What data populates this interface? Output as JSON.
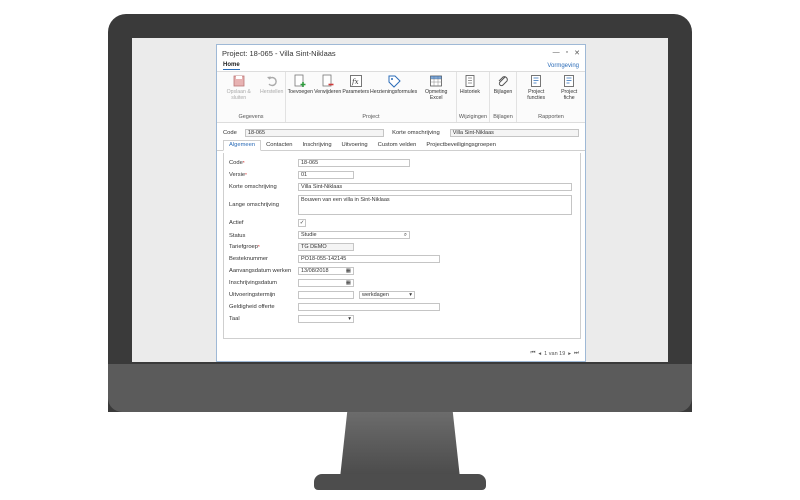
{
  "window": {
    "title": "Project: 18-065 - Villa Sint-Niklaas"
  },
  "ribbon": {
    "tab_home": "Home",
    "tab_vormgeving": "Vormgeving",
    "groups": [
      {
        "label": "Gegevens",
        "buttons": [
          "Opslaan & sluiten",
          "Herstellen"
        ]
      },
      {
        "label": "Project",
        "buttons": [
          "Toevoegen",
          "Verwijderen",
          "Parameters",
          "Herzieningsformules",
          "Opmeting Excel"
        ]
      },
      {
        "label": "Wijzigingen",
        "buttons": [
          "Historiek"
        ]
      },
      {
        "label": "Bijlagen",
        "buttons": [
          "Bijlagen"
        ]
      },
      {
        "label": "Rapporten",
        "buttons": [
          "Project functies",
          "Project fiche"
        ]
      }
    ]
  },
  "header": {
    "code_label": "Code",
    "code_value": "18-065",
    "korte_label": "Korte omschrijving",
    "korte_value": "Villa Sint-Niklaas"
  },
  "tabs": [
    "Algemeen",
    "Contacten",
    "Inschrijving",
    "Uitvoering",
    "Custom velden",
    "Projectbeveiligingsgroepen"
  ],
  "form": {
    "code": {
      "label": "Code",
      "value": "18-065"
    },
    "versie": {
      "label": "Versie",
      "value": "01"
    },
    "korte": {
      "label": "Korte omschrijving",
      "value": "Villa Sint-Niklaas"
    },
    "lange": {
      "label": "Lange omschrijving",
      "value": "Bouwen van een villa in Sint-Niklaas"
    },
    "actief": {
      "label": "Actief",
      "value": "✓"
    },
    "status": {
      "label": "Status",
      "value": "Studie"
    },
    "tariefgroep": {
      "label": "Tariefgroep",
      "value": "TG DEMO"
    },
    "besteknummer": {
      "label": "Besteknummer",
      "value": "PO18-055-142145"
    },
    "aanvangsdatum": {
      "label": "Aanvangsdatum werken",
      "value": "13/08/2018"
    },
    "inschrijvingsdatum": {
      "label": "Inschrijvingsdatum",
      "value": ""
    },
    "uitvoeringstermijn": {
      "label": "Uitvoeringstermijn",
      "value": "",
      "unit": "werkdagen"
    },
    "geldigheid": {
      "label": "Geldigheid offerte",
      "value": ""
    },
    "taal": {
      "label": "Taal",
      "value": ""
    }
  },
  "pager": {
    "text": "1 van 19"
  },
  "colors": {
    "accent": "#2b6cb8",
    "border": "#9fb9d6"
  }
}
